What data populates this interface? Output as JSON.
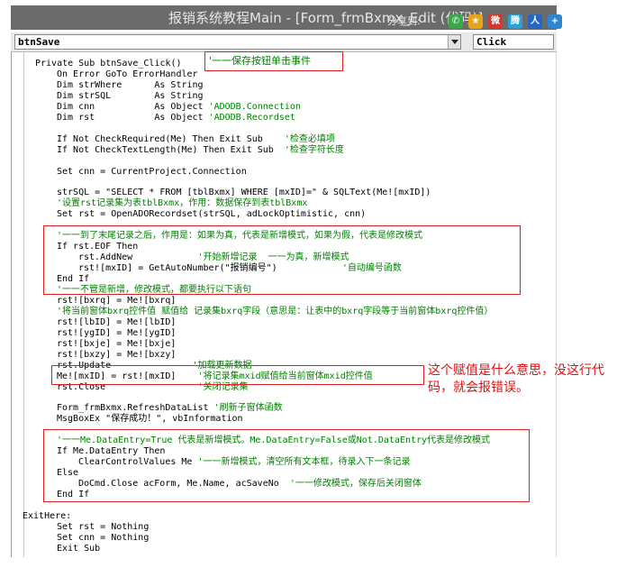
{
  "window": {
    "title": "报销系统教程Main - [Form_frmBxmx_Edit (代码)]",
    "share_label": "分享到:",
    "share_icons": [
      {
        "name": "wechat-icon",
        "glyph": "✆",
        "color": "#3aa84a"
      },
      {
        "name": "qzone-icon",
        "glyph": "★",
        "color": "#e8a31a"
      },
      {
        "name": "weibo-icon",
        "glyph": "微",
        "color": "#d9352c"
      },
      {
        "name": "tencent-weibo-icon",
        "glyph": "腾",
        "color": "#2aa0d8"
      },
      {
        "name": "renren-icon",
        "glyph": "人",
        "color": "#2466c4"
      },
      {
        "name": "more-share-icon",
        "glyph": "+",
        "color": "#2f86d0"
      }
    ]
  },
  "combos": {
    "object": "btnSave",
    "procedure": "Click"
  },
  "code_lines": [
    {
      "indent": 1,
      "parts": [
        {
          "t": "Private Sub btnSave_Click()",
          "c": "code"
        }
      ]
    },
    {
      "indent": 2,
      "parts": [
        {
          "t": "On Error GoTo ErrorHandler",
          "c": "code"
        }
      ]
    },
    {
      "indent": 2,
      "parts": [
        {
          "t": "Dim strWhere      As String",
          "c": "code"
        }
      ]
    },
    {
      "indent": 2,
      "parts": [
        {
          "t": "Dim strSQL        As String",
          "c": "code"
        }
      ]
    },
    {
      "indent": 2,
      "parts": [
        {
          "t": "Dim cnn           As Object ",
          "c": "code"
        },
        {
          "t": "'ADODB.Connection",
          "c": "cm"
        }
      ]
    },
    {
      "indent": 2,
      "parts": [
        {
          "t": "Dim rst           As Object ",
          "c": "code"
        },
        {
          "t": "'ADODB.Recordset",
          "c": "cm"
        }
      ]
    },
    {
      "indent": 0,
      "parts": []
    },
    {
      "indent": 2,
      "parts": [
        {
          "t": "If Not CheckRequired(Me) Then Exit Sub    ",
          "c": "code"
        },
        {
          "t": "'检查必填项",
          "c": "cm"
        }
      ]
    },
    {
      "indent": 2,
      "parts": [
        {
          "t": "If Not CheckTextLength(Me) Then Exit Sub  ",
          "c": "code"
        },
        {
          "t": "'检查字符长度",
          "c": "cm"
        }
      ]
    },
    {
      "indent": 0,
      "parts": []
    },
    {
      "indent": 2,
      "parts": [
        {
          "t": "Set cnn = CurrentProject.Connection",
          "c": "code"
        }
      ]
    },
    {
      "indent": 0,
      "parts": []
    },
    {
      "indent": 2,
      "parts": [
        {
          "t": "strSQL = \"SELECT * FROM [tblBxmx] WHERE [mxID]=\" & SQLText(Me![mxID])",
          "c": "code"
        }
      ]
    },
    {
      "indent": 2,
      "parts": [
        {
          "t": "'设置rst记录集为表tblBxmx，作用：数据保存到表tblBxmx",
          "c": "cm"
        }
      ]
    },
    {
      "indent": 2,
      "parts": [
        {
          "t": "Set rst = OpenADORecordset(strSQL, adLockOptimistic, cnn)",
          "c": "code"
        }
      ]
    },
    {
      "indent": 0,
      "parts": []
    },
    {
      "indent": 2,
      "parts": [
        {
          "t": "'一一到了末尾记录之后，作用是：如果为真，代表是新增模式，如果为假，代表是修改模式",
          "c": "cm"
        }
      ]
    },
    {
      "indent": 2,
      "parts": [
        {
          "t": "If rst.EOF Then",
          "c": "code"
        }
      ]
    },
    {
      "indent": 3,
      "parts": [
        {
          "t": "rst.AddNew            ",
          "c": "code"
        },
        {
          "t": "'开始新增记录  一一为真，新增模式",
          "c": "cm"
        }
      ]
    },
    {
      "indent": 3,
      "parts": [
        {
          "t": "rst![mxID] = GetAutoNumber(\"报销编号\")            ",
          "c": "code"
        },
        {
          "t": "'自动编号函数",
          "c": "cm"
        }
      ]
    },
    {
      "indent": 2,
      "parts": [
        {
          "t": "End If",
          "c": "code"
        }
      ]
    },
    {
      "indent": 2,
      "parts": [
        {
          "t": "'一一不管是新增，修改模式，都要执行以下语句",
          "c": "cm"
        }
      ]
    },
    {
      "indent": 2,
      "parts": [
        {
          "t": "rst![bxrq] = Me![bxrq]",
          "c": "code"
        }
      ]
    },
    {
      "indent": 2,
      "parts": [
        {
          "t": "'将当前窗体bxrq控件值 赋值给 记录集bxrq字段（意思是：让表中的bxrq字段等于当前窗体bxrq控件值）",
          "c": "cm"
        }
      ]
    },
    {
      "indent": 2,
      "parts": [
        {
          "t": "rst![lbID] = Me![lbID]",
          "c": "code"
        }
      ]
    },
    {
      "indent": 2,
      "parts": [
        {
          "t": "rst![ygID] = Me![ygID]",
          "c": "code"
        }
      ]
    },
    {
      "indent": 2,
      "parts": [
        {
          "t": "rst![bxje] = Me![bxje]",
          "c": "code"
        }
      ]
    },
    {
      "indent": 2,
      "parts": [
        {
          "t": "rst![bxzy] = Me![bxzy]",
          "c": "code"
        }
      ]
    },
    {
      "indent": 2,
      "parts": [
        {
          "t": "rst.Update               ",
          "c": "code"
        },
        {
          "t": "'加载更新数据",
          "c": "cm"
        }
      ]
    },
    {
      "indent": 2,
      "parts": [
        {
          "t": "Me![mxID] = rst![mxID]    ",
          "c": "code"
        },
        {
          "t": "'将记录集mxid赋值给当前窗体mxid控件值",
          "c": "cm"
        }
      ]
    },
    {
      "indent": 2,
      "parts": [
        {
          "t": "rst.Close                 ",
          "c": "code"
        },
        {
          "t": "'关闭记录集",
          "c": "cm"
        }
      ]
    },
    {
      "indent": 0,
      "parts": []
    },
    {
      "indent": 2,
      "parts": [
        {
          "t": "Form_frmBxmx.RefreshDataList ",
          "c": "code"
        },
        {
          "t": "'刷新子窗体函数",
          "c": "cm"
        }
      ]
    },
    {
      "indent": 2,
      "parts": [
        {
          "t": "MsgBoxEx \"保存成功！\", vbInformation",
          "c": "code"
        }
      ]
    },
    {
      "indent": 0,
      "parts": []
    },
    {
      "indent": 2,
      "parts": [
        {
          "t": "'一一Me.DataEntry=True 代表是新增模式。Me.DataEntry=False或Not.DataEntry代表是修改模式",
          "c": "cm"
        }
      ]
    },
    {
      "indent": 2,
      "parts": [
        {
          "t": "If Me.DataEntry Then",
          "c": "code"
        }
      ]
    },
    {
      "indent": 3,
      "parts": [
        {
          "t": "ClearControlValues Me ",
          "c": "code"
        },
        {
          "t": "'一一新增模式，清空所有文本框，待录入下一条记录",
          "c": "cm"
        }
      ]
    },
    {
      "indent": 2,
      "parts": [
        {
          "t": "Else",
          "c": "code"
        }
      ]
    },
    {
      "indent": 3,
      "parts": [
        {
          "t": "DoCmd.Close acForm, Me.Name, acSaveNo  ",
          "c": "code"
        },
        {
          "t": "'一一修改模式，保存后关闭窗体",
          "c": "cm"
        }
      ]
    },
    {
      "indent": 2,
      "parts": [
        {
          "t": "End If",
          "c": "code"
        }
      ]
    },
    {
      "indent": 0,
      "parts": []
    },
    {
      "indent": 0,
      "parts": [
        {
          "t": "ExitHere:",
          "c": "code"
        }
      ]
    },
    {
      "indent": 2,
      "parts": [
        {
          "t": "Set rst = Nothing",
          "c": "code"
        }
      ]
    },
    {
      "indent": 2,
      "parts": [
        {
          "t": "Set cnn = Nothing",
          "c": "code"
        }
      ]
    },
    {
      "indent": 2,
      "parts": [
        {
          "t": "Exit Sub",
          "c": "code"
        }
      ]
    }
  ],
  "annotations": {
    "save_click_comment": "'一一保存按钮单击事件",
    "question_note": "这个赋值是什么意思，没这行代码，就会报错误。"
  },
  "colors": {
    "comment": "#008000",
    "annotation_red": "#e02020",
    "titlebar": "#6b6b6b"
  }
}
